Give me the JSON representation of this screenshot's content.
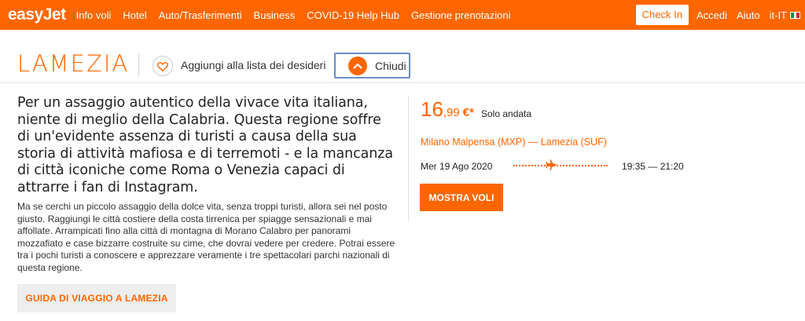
{
  "header": {
    "logo": "easyJet",
    "nav": [
      "Info voli",
      "Hotel",
      "Auto/Trasferimenti",
      "Business",
      "COVID-19 Help Hub",
      "Gestione prenotazioni"
    ],
    "checkin": "Check In",
    "login": "Accedi",
    "help": "Aiuto",
    "language": "it-IT"
  },
  "destination": {
    "city": "LAMEZIA",
    "wishlist_label": "Aggiungi alla lista dei desideri",
    "close_label": "Chiudi"
  },
  "content": {
    "lead": "Per un assaggio autentico della vivace vita italiana, niente di meglio della Calabria. Questa regione soffre di un'evidente assenza di turisti a causa della sua storia di attività mafiosa e di terremoti - e la mancanza di città iconiche come Roma o Venezia capaci di attrarre i fan di Instagram.",
    "body": "Ma se cerchi un piccolo assaggio della dolce vita, senza troppi turisti, allora sei nel posto giusto. Raggiungi le città costiere della costa tirrenica per spiagge sensazionali e mai affollate. Arrampicati fino alla città di montagna di Morano Calabro per panorami mozzafiato e case bizzarre costruite su cime, che dovrai vedere per credere. Potrai essere tra i pochi turisti a conoscere e apprezzare veramente i tre spettacolari parchi nazionali di questa regione.",
    "guide_button": "GUIDA DI VIAGGIO A LAMEZIA"
  },
  "flight": {
    "price_int": "16",
    "price_dec": ",99",
    "currency": "€*",
    "trip_type": "Solo andata",
    "route": "Milano Malpensa (MXP) — Lamezia (SUF)",
    "date": "Mer 19 Ago 2020",
    "times": "19:35 — 21:20",
    "button": "MOSTRA VOLI"
  },
  "colors": {
    "brand": "#ff6600",
    "focus_outline": "#6b8cc9"
  },
  "icons": {
    "wishlist": "heart-icon",
    "close": "chevron-up-icon",
    "flight": "airplane-icon",
    "flag": "italy-flag-icon"
  }
}
